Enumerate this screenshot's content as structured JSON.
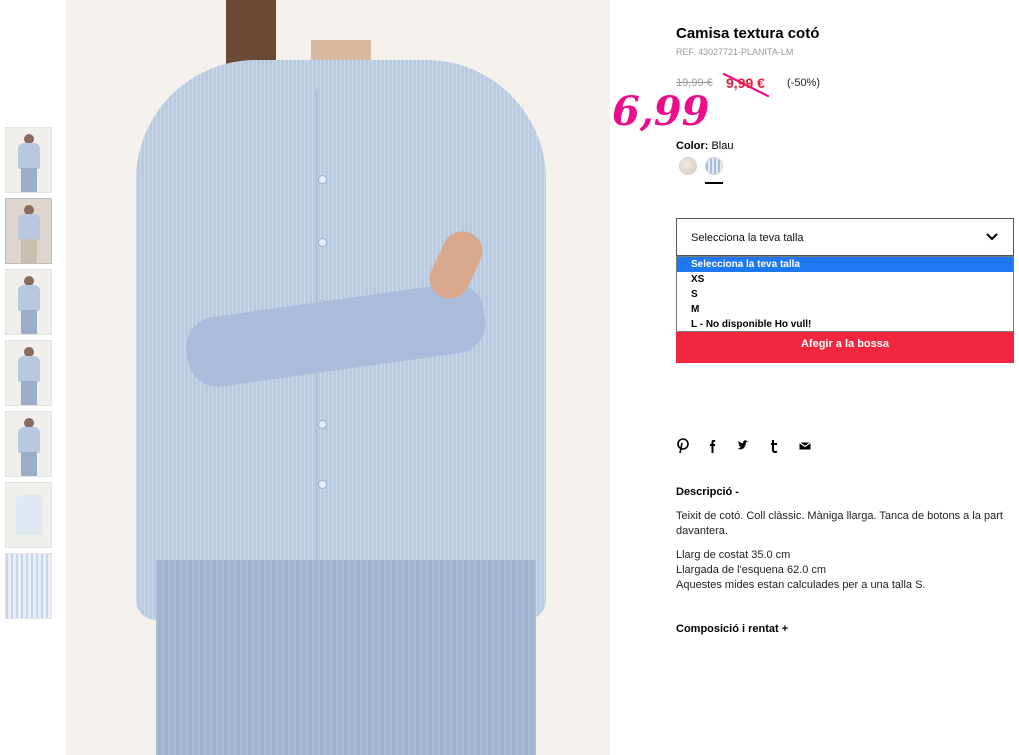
{
  "product": {
    "title": "Camisa textura cotó",
    "ref": "REF. 43027721-PLANITA-LM",
    "old_price": "19,99 €",
    "sale_price": "9,99 €",
    "discount": "(-50%)",
    "handwritten_price": "6,99",
    "color_label": "Color:",
    "color_value": " Blau"
  },
  "size_select": {
    "label": "Selecciona la teva talla",
    "options": [
      "Selecciona la teva talla",
      "XS",
      "S",
      "M",
      "L - No disponible Ho vull!"
    ],
    "highlighted_index": 0
  },
  "add_button": "Afegir a la bossa",
  "social_icons": [
    "pinterest-icon",
    "facebook-icon",
    "twitter-icon",
    "tumblr-icon",
    "mail-icon"
  ],
  "description": {
    "title": "Descripció  -",
    "text1": "Teixit de cotó. Coll clàssic. Màniga llarga. Tanca de botons a la part davantera.",
    "line1": "Llarg de costat 35.0 cm",
    "line2": "Llargada de l'esquena 62.0 cm",
    "line3": "Aquestes mides estan calculades per a una talla S."
  },
  "composition": {
    "title": "Composició i rentat  +"
  },
  "colors": {
    "accent_red": "#f0273f",
    "sale_red": "#e8203a",
    "highlight_blue": "#1e78f0",
    "handwritten_pink": "#ec0d8d"
  }
}
